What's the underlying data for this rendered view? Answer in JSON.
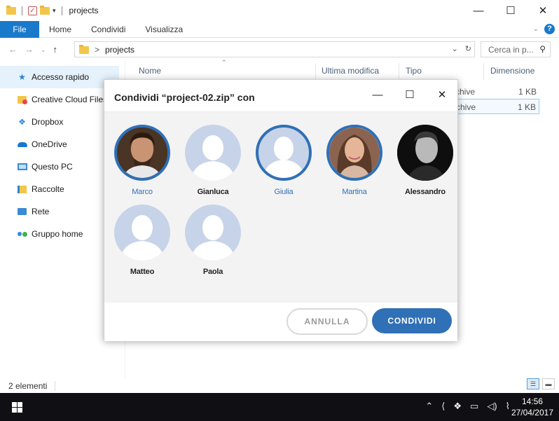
{
  "window": {
    "title": "projects",
    "minimize": "—",
    "maximize": "☐",
    "close": "✕"
  },
  "ribbon": {
    "file": "File",
    "tabs": [
      "Home",
      "Condividi",
      "Visualizza"
    ]
  },
  "address": {
    "separator": ">",
    "path": "projects",
    "refresh": "↻",
    "search_placeholder": "Cerca in p..."
  },
  "sidebar": {
    "items": [
      {
        "label": "Accesso rapido",
        "icon": "star-icon"
      },
      {
        "label": "Creative Cloud Files",
        "icon": "creative-cloud-icon"
      },
      {
        "label": "Dropbox",
        "icon": "dropbox-icon"
      },
      {
        "label": "OneDrive",
        "icon": "onedrive-icon"
      },
      {
        "label": "Questo PC",
        "icon": "computer-icon"
      },
      {
        "label": "Raccolte",
        "icon": "libraries-icon"
      },
      {
        "label": "Rete",
        "icon": "network-icon"
      },
      {
        "label": "Gruppo home",
        "icon": "homegroup-icon"
      }
    ]
  },
  "columns": {
    "name": "Nome",
    "modified": "Ultima modifica",
    "type": "Tipo",
    "size": "Dimensione"
  },
  "files": [
    {
      "type": "rchive",
      "size": "1 KB"
    },
    {
      "type": "rchive",
      "size": "1 KB"
    }
  ],
  "status": {
    "count": "2 elementi"
  },
  "taskbar": {
    "time": "14:56",
    "date": "27/04/2017"
  },
  "dialog": {
    "title": "Condividi “project-02.zip” con",
    "contacts": [
      {
        "name": "Marco",
        "selected": true,
        "photo": true
      },
      {
        "name": "Gianluca",
        "selected": false,
        "photo": false
      },
      {
        "name": "Giulia",
        "selected": true,
        "photo": false
      },
      {
        "name": "Martina",
        "selected": true,
        "photo": true
      },
      {
        "name": "Alessandro",
        "selected": false,
        "photo": true
      },
      {
        "name": "Matteo",
        "selected": false,
        "photo": false
      },
      {
        "name": "Paola",
        "selected": false,
        "photo": false
      }
    ],
    "cancel_label": "ANNULLA",
    "share_label": "CONDIVIDI"
  },
  "colors": {
    "accent": "#2f70b6",
    "ribbon_file": "#1979ca",
    "placeholder_avatar": "#c7d3e8",
    "taskbar": "#0f0f14"
  }
}
